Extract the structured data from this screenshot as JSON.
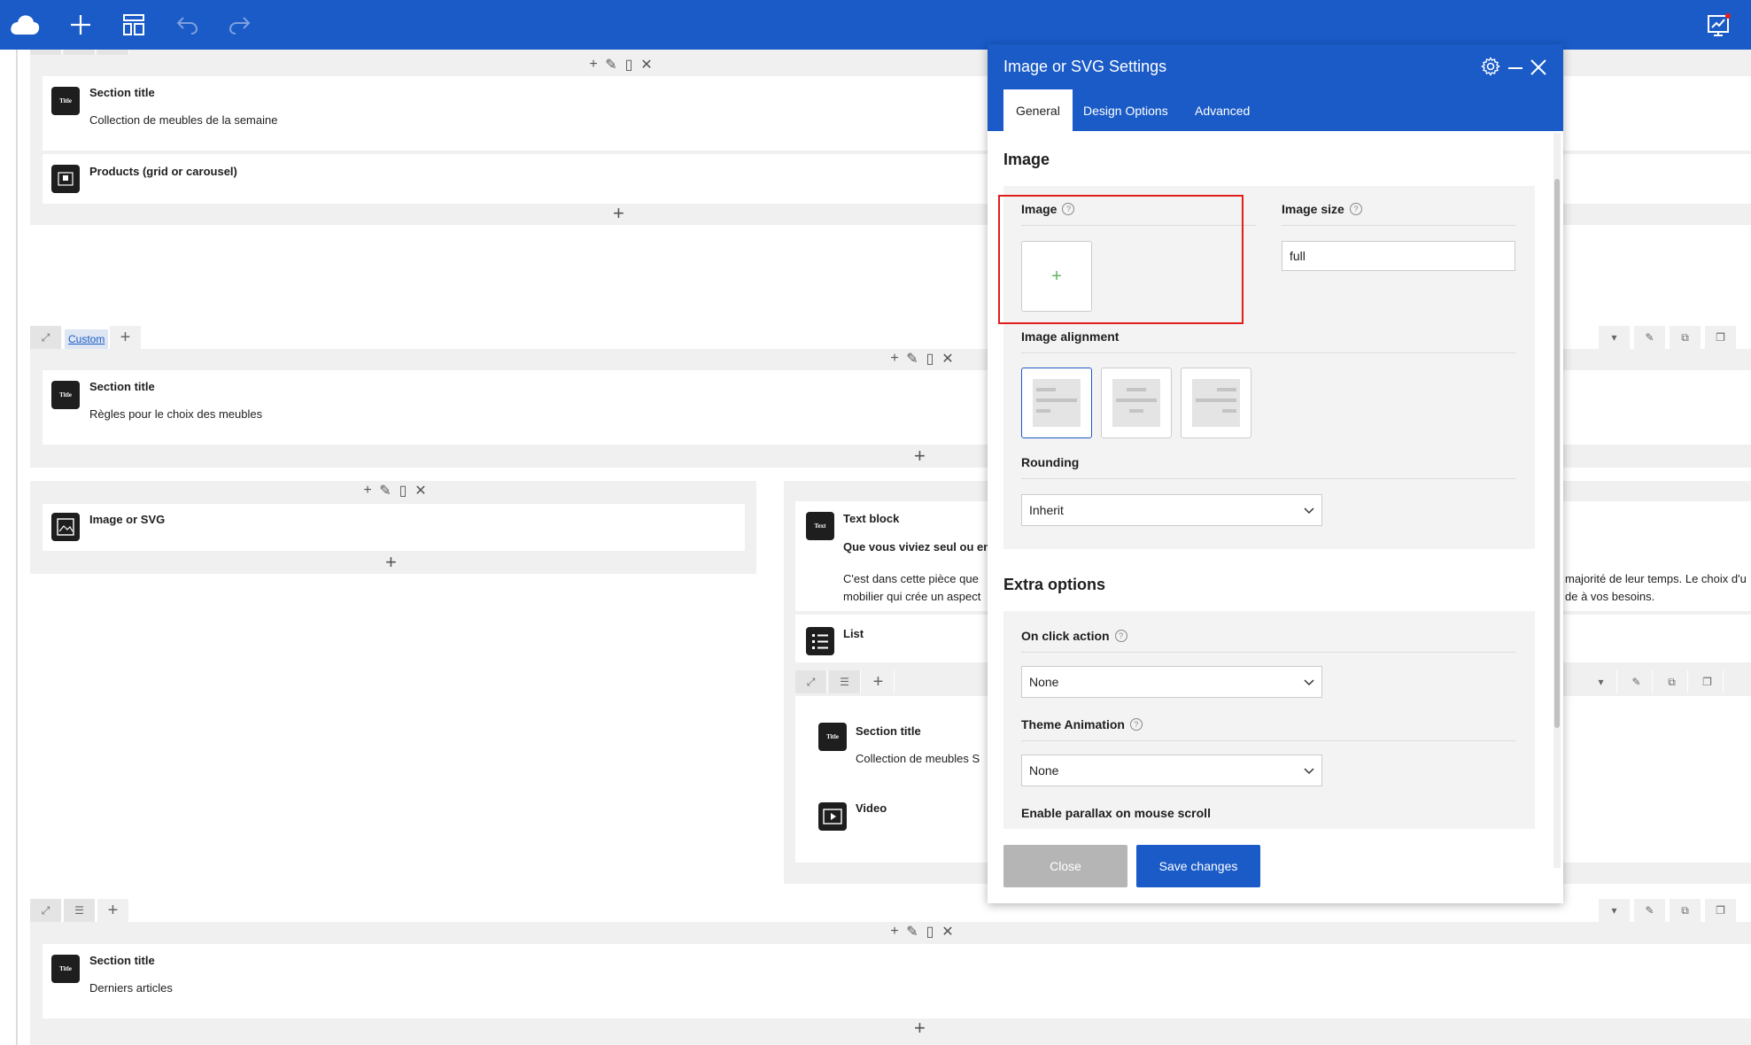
{
  "colors": {
    "primary": "#1a5bc7",
    "highlight": "#e11d1d",
    "add_green": "#5cb85c"
  },
  "topbar": {
    "logo": "cloud-logo-icon",
    "buttons": [
      "plus-icon",
      "layout-icon",
      "undo-icon",
      "redo-icon",
      "analytics-icon"
    ]
  },
  "builder": {
    "row1": {
      "elements": [
        {
          "title": "Section title",
          "subtitle": "Collection de meubles de la semaine",
          "icon_text": "Title"
        },
        {
          "title": "Products (grid or carousel)",
          "subtitle": ""
        }
      ]
    },
    "row2": {
      "custom_label": "Custom",
      "elements": [
        {
          "title": "Section title",
          "subtitle": "Règles pour le choix des meubles",
          "icon_text": "Title"
        }
      ]
    },
    "row3": {
      "left": {
        "title": "Image or SVG"
      },
      "right": {
        "text_block": {
          "title": "Text block",
          "icon_text": "Text",
          "line1": "Que vous viviez seul ou en",
          "line2": "C'est dans cette pièce que",
          "line3": "mobilier qui crée un aspect",
          "line2_right": "majorité de leur temps. Le choix d'u",
          "line3_right": "de à vos besoins."
        },
        "list": {
          "title": "List"
        },
        "inner": {
          "section_title": "Section title",
          "section_subtitle": "Collection de meubles S",
          "icon_text": "Title",
          "video_title": "Video"
        }
      }
    },
    "row4": {
      "elements": [
        {
          "title": "Section title",
          "subtitle": "Derniers articles",
          "icon_text": "Title"
        }
      ]
    }
  },
  "modal": {
    "title": "Image or SVG Settings",
    "tabs": [
      "General",
      "Design Options",
      "Advanced"
    ],
    "active_tab": "General",
    "image_section": {
      "heading": "Image",
      "image_label": "Image",
      "image_size_label": "Image size",
      "image_size_value": "full",
      "alignment_label": "Image alignment",
      "alignment_options": [
        "left",
        "center",
        "right"
      ],
      "alignment_selected": "left",
      "rounding_label": "Rounding",
      "rounding_value": "Inherit"
    },
    "extra_section": {
      "heading": "Extra options",
      "on_click_label": "On click action",
      "on_click_value": "None",
      "theme_animation_label": "Theme Animation",
      "theme_animation_value": "None",
      "parallax_label": "Enable parallax on mouse scroll"
    },
    "buttons": {
      "close": "Close",
      "save": "Save changes"
    }
  }
}
